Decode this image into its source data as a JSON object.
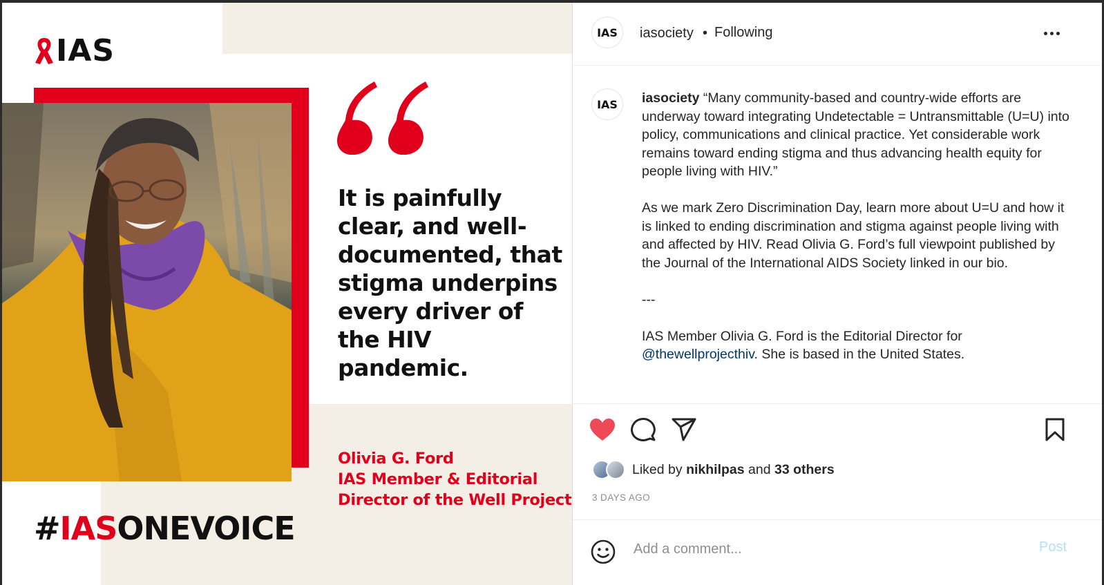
{
  "post_image": {
    "logo_text": "IAS",
    "quote": "It is painfully clear, and well-documented, that stigma underpins every driver of the HIV pandemic.",
    "credit_lines": [
      "Olivia G. Ford",
      "IAS Member & Editorial",
      "Director of the Well Project"
    ],
    "hashtag_prefix": "#",
    "hashtag_highlight": "IAS",
    "hashtag_rest": "ONEVOICE",
    "brand_red": "#e0001b"
  },
  "header": {
    "avatar_text": "IAS",
    "username": "iasociety",
    "separator": "•",
    "follow_status": "Following"
  },
  "caption": {
    "avatar_text": "IAS",
    "username": "iasociety",
    "paragraph1": "“Many community-based and country-wide efforts are underway toward integrating Undetectable = Untransmittable (U=U) into policy, communications and clinical practice. Yet considerable work remains toward ending stigma and thus advancing health equity for people living with HIV.”",
    "paragraph2": "As we mark Zero Discrimination Day, learn more about U=U and how it is linked to ending discrimination and stigma against people living with and affected by HIV. Read Olivia G. Ford’s full viewpoint published by the Journal of the International AIDS Society linked in our bio.",
    "divider": "---",
    "paragraph3_start": "IAS Member Olivia G. Ford is the Editorial Director for ",
    "mention": "@thewellprojecthiv",
    "paragraph3_end": ". She is based in the United States."
  },
  "actions": {
    "like_icon": "heart-filled-icon",
    "comment_icon": "comment-icon",
    "share_icon": "send-icon",
    "save_icon": "bookmark-icon",
    "like_color": "#ed4956"
  },
  "likes": {
    "prefix": "Liked by",
    "user": "nikhilpas",
    "middle": "and",
    "others": "33 others"
  },
  "date": "3 DAYS AGO",
  "comment": {
    "placeholder": "Add a comment...",
    "post_label": "Post"
  }
}
